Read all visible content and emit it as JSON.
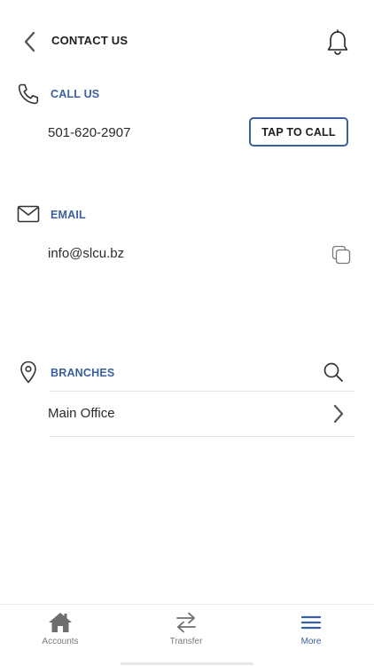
{
  "header": {
    "title": "CONTACT US",
    "back_icon": "chevron-left-icon",
    "bell_icon": "bell-icon"
  },
  "call": {
    "title": "CALL US",
    "icon": "phone-icon",
    "phone": "501-620-2907",
    "button_label": "TAP TO CALL"
  },
  "email": {
    "title": "EMAIL",
    "icon": "envelope-icon",
    "address": "info@slcu.bz",
    "copy_icon": "copy-icon"
  },
  "branches": {
    "title": "BRANCHES",
    "icon": "map-pin-icon",
    "search_icon": "search-icon",
    "items": [
      {
        "name": "Main Office"
      }
    ]
  },
  "bottom_nav": {
    "items": [
      {
        "label": "Accounts",
        "icon": "home-icon",
        "active": false
      },
      {
        "label": "Transfer",
        "icon": "transfer-arrows-icon",
        "active": false
      },
      {
        "label": "More",
        "icon": "hamburger-menu-icon",
        "active": true
      }
    ]
  },
  "colors": {
    "accent": "#3a5f9e",
    "text": "#2a2a2a",
    "muted": "#7a7a7a",
    "divider": "#e4e4e4"
  }
}
